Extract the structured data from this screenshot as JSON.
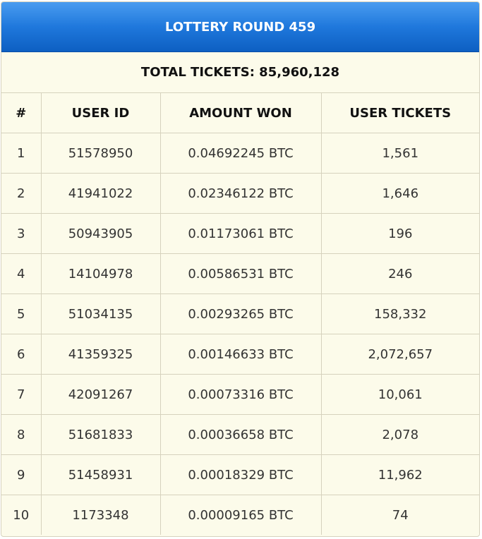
{
  "header": {
    "title": "LOTTERY ROUND 459",
    "total_tickets": "TOTAL TICKETS: 85,960,128"
  },
  "table": {
    "columns": [
      "#",
      "USER ID",
      "AMOUNT WON",
      "USER TICKETS"
    ],
    "rows": [
      [
        "1",
        "51578950",
        "0.04692245 BTC",
        "1,561"
      ],
      [
        "2",
        "41941022",
        "0.02346122 BTC",
        "1,646"
      ],
      [
        "3",
        "50943905",
        "0.01173061 BTC",
        "196"
      ],
      [
        "4",
        "14104978",
        "0.00586531 BTC",
        "246"
      ],
      [
        "5",
        "51034135",
        "0.00293265 BTC",
        "158,332"
      ],
      [
        "6",
        "41359325",
        "0.00146633 BTC",
        "2,072,657"
      ],
      [
        "7",
        "42091267",
        "0.00073316 BTC",
        "10,061"
      ],
      [
        "8",
        "51681833",
        "0.00036658 BTC",
        "2,078"
      ],
      [
        "9",
        "51458931",
        "0.00018329 BTC",
        "11,962"
      ],
      [
        "10",
        "1173348",
        "0.00009165 BTC",
        "74"
      ]
    ]
  }
}
